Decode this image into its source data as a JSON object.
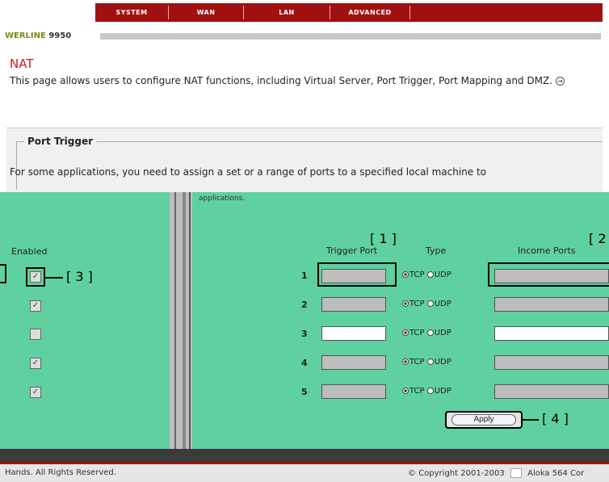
{
  "nav": {
    "tabs": [
      "SYSTEM",
      "WAN",
      "LAN",
      "ADVANCED"
    ]
  },
  "brand": {
    "prefix": "WERLINE",
    "model": "9950"
  },
  "nat": {
    "title": "NAT",
    "description": "This page allows users to configure NAT functions, including Virtual Server, Port Trigger, Port Mapping and DMZ."
  },
  "port_trigger": {
    "legend": "Port Trigger",
    "description": "For some applications, you need to assign a set or a range of ports to a specified local machine to",
    "apps_label": "applications.",
    "enabled_header": "Enabled",
    "trigger_port_header": "Trigger Port",
    "type_header": "Type",
    "income_ports_header": "Income Ports",
    "tcp_label": "TCP",
    "udp_label": "UDP",
    "apply_label": "Apply",
    "rows": [
      {
        "num": "1",
        "trigger": "",
        "income": "",
        "enabled": true
      },
      {
        "num": "2",
        "trigger": "",
        "income": "",
        "enabled": true
      },
      {
        "num": "3",
        "trigger": "",
        "income": "",
        "enabled": false
      },
      {
        "num": "4",
        "trigger": "",
        "income": "",
        "enabled": true
      },
      {
        "num": "5",
        "trigger": "",
        "income": "",
        "enabled": true
      }
    ]
  },
  "callouts": {
    "c1": "[ 1 ]",
    "c2": "[ 2",
    "c3": "[ 3 ]",
    "c4": "[ 4 ]"
  },
  "footer": {
    "left": "Hands. All Rights Reserved.",
    "right": "Copyright 2001-2003",
    "right_suffix": "Aloka 564 Cor"
  },
  "colors": {
    "nav_red": "#a01010",
    "panel_green": "#5fd0a0",
    "title_red": "#c02020"
  }
}
